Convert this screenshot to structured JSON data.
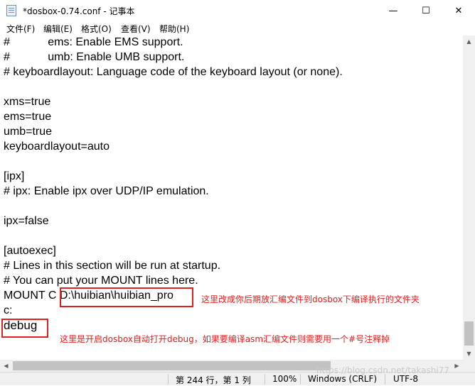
{
  "window": {
    "title": "*dosbox-0.74.conf - 记事本",
    "minimize_glyph": "—",
    "maximize_glyph": "☐",
    "close_glyph": "✕"
  },
  "menu": {
    "items": [
      "文件(F)",
      "编辑(E)",
      "格式(O)",
      "查看(V)",
      "帮助(H)"
    ]
  },
  "editor": {
    "lines": [
      "#            ems: Enable EMS support.",
      "#            umb: Enable UMB support.",
      "# keyboardlayout: Language code of the keyboard layout (or none).",
      "",
      "xms=true",
      "ems=true",
      "umb=true",
      "keyboardlayout=auto",
      "",
      "[ipx]",
      "# ipx: Enable ipx over UDP/IP emulation.",
      "",
      "ipx=false",
      "",
      "[autoexec]",
      "# Lines in this section will be run at startup.",
      "# You can put your MOUNT lines here.",
      "MOUNT C D:\\huibian\\huibian_pro",
      "c:",
      "debug"
    ]
  },
  "annotations": {
    "mount_note": "这里改成你后期放汇编文件到dosbox下编译执行的文件夹",
    "debug_note": "这里是开启dosbox自动打开debug，如果要编译asm汇编文件则需要用一个#号注释掉",
    "highlight_color": "#e02020"
  },
  "status": {
    "position": "第 244 行，第 1 列",
    "zoom": "100%",
    "line_ending": "Windows (CRLF)",
    "encoding": "UTF-8"
  },
  "watermark": "https://blog.csdn.net/takashi77"
}
